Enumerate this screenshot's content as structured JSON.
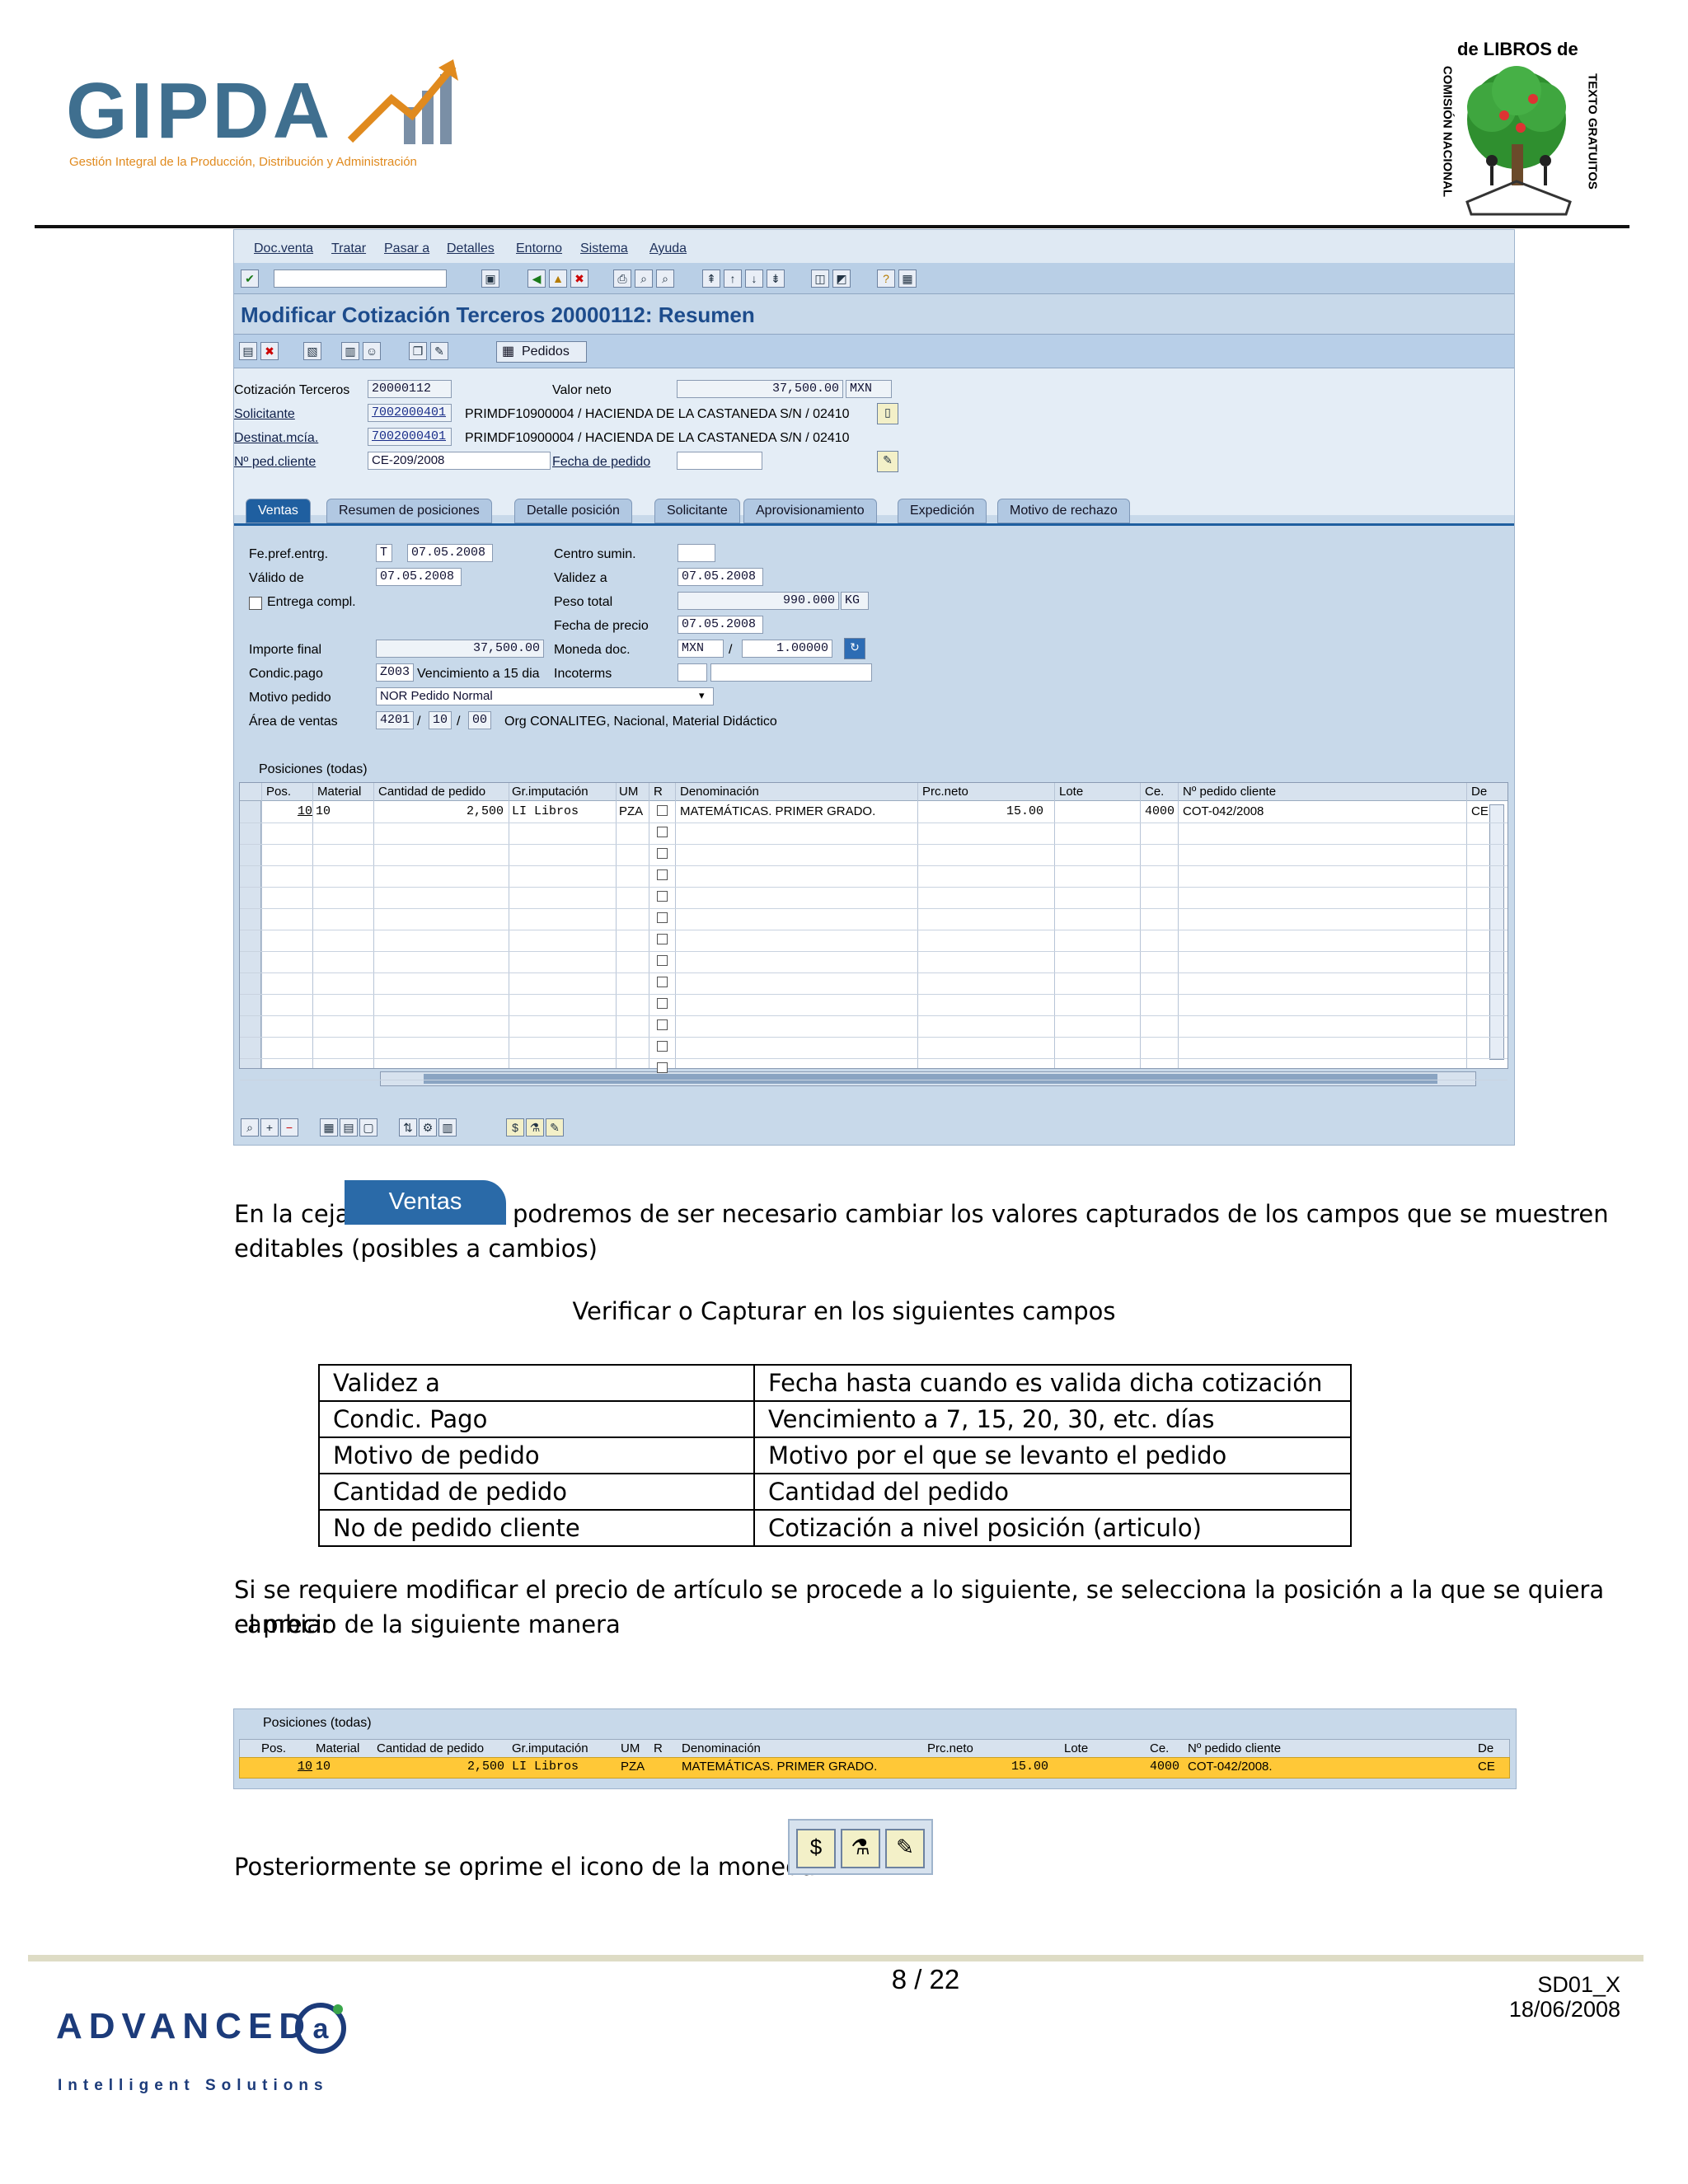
{
  "header": {
    "logo_left_word": "GIPDA",
    "logo_left_tagline": "Gestión Integral de la Producción, Distribución y Administración",
    "logo_right_top": "de LIBROS de",
    "logo_right_left": "COMISIÓN NACIONAL",
    "logo_right_right": "TEXTO GRATUITOS"
  },
  "sap": {
    "menu": [
      "Doc.venta",
      "Tratar",
      "Pasar a",
      "Detalles",
      "Entorno",
      "Sistema",
      "Ayuda"
    ],
    "title": "Modificar Cotización Terceros 20000112: Resumen",
    "pedidos_label": "Pedidos",
    "header_fields": {
      "cotizacion_label": "Cotización Terceros",
      "cotizacion_value": "20000112",
      "valor_neto_label": "Valor neto",
      "valor_neto_value": "37,500.00",
      "valor_neto_currency": "MXN",
      "solicitante_label": "Solicitante",
      "solicitante_value": "7002000401",
      "solicitante_text": "PRIMDF10900004 / HACIENDA DE LA CASTANEDA S/N / 02410",
      "destinat_label": "Destinat.mcía.",
      "destinat_value": "7002000401",
      "destinat_text": "PRIMDF10900004 / HACIENDA DE LA CASTANEDA S/N / 02410",
      "pedcliente_label": "Nº ped.cliente",
      "pedcliente_value": "CE-209/2008",
      "fecha_pedido_label": "Fecha de pedido"
    },
    "tabs": [
      "Ventas",
      "Resumen de posiciones",
      "Detalle posición",
      "Solicitante",
      "Aprovisionamiento",
      "Expedición",
      "Motivo de rechazo"
    ],
    "ventas": {
      "fe_pref_label": "Fe.pref.entrg.",
      "fe_pref_unit": "T",
      "fe_pref_value": "07.05.2008",
      "valido_label": "Válido de",
      "valido_value": "07.05.2008",
      "entrega_label": "Entrega compl.",
      "centro_label": "Centro sumin.",
      "validez_label": "Validez a",
      "validez_value": "07.05.2008",
      "peso_label": "Peso total",
      "peso_value": "990.000",
      "peso_unit": "KG",
      "fecha_precio_label": "Fecha de precio",
      "fecha_precio_value": "07.05.2008",
      "importe_label": "Importe final",
      "importe_value": "37,500.00",
      "moneda_label": "Moneda doc.",
      "moneda_value": "MXN",
      "moneda_rate": "1.00000",
      "condic_label": "Condic.pago",
      "condic_value": "Z003",
      "condic_text": "Vencimiento a 15 dia",
      "incoterms_label": "Incoterms",
      "motivo_label": "Motivo pedido",
      "motivo_value": "NOR Pedido Normal",
      "area_label": "Área de ventas",
      "area_v1": "4201",
      "area_v2": "10",
      "area_v3": "00",
      "area_text": "Org CONALITEG, Nacional, Material Didáctico",
      "sep": "/"
    },
    "grid": {
      "caption": "Posiciones (todas)",
      "columns": [
        "Pos.",
        "Material",
        "Cantidad de pedido",
        "Gr.imputación",
        "UM",
        "R",
        "Denominación",
        "Prc.neto",
        "Lote",
        "Ce.",
        "Nº pedido cliente",
        "De"
      ],
      "row": {
        "pos": "10",
        "material": "10",
        "cantidad": "2,500",
        "grimp": "LI Libros",
        "um": "PZA",
        "denominacion": "MATEMÁTICAS. PRIMER GRADO.",
        "prcneto": "15.00",
        "ce": "4000",
        "pedcliente": "COT-042/2008",
        "de": "CE"
      }
    }
  },
  "body": {
    "para1_a": "En la ceja",
    "ventas_tab": "Ventas",
    "para1_b": "podremos de ser necesario cambiar los valores capturados de los campos que se muestren",
    "para1_c": "editables (posibles a cambios)",
    "center": "Verificar o Capturar en los siguientes campos",
    "table": [
      [
        "Validez a",
        "Fecha hasta cuando es valida dicha cotización"
      ],
      [
        "Condic. Pago",
        "Vencimiento a 7, 15, 20, 30, etc. días"
      ],
      [
        "Motivo de pedido",
        "Motivo por el que se levanto el pedido"
      ],
      [
        "Cantidad de pedido",
        "Cantidad del pedido"
      ],
      [
        "No de pedido cliente",
        "Cotización a nivel posición (articulo)"
      ]
    ],
    "para2_a": "Si se requiere modificar el precio de artículo se procede a lo siguiente, se selecciona la posición a la que se quiera cambiar",
    "para2_b": "el precio de la siguiente manera",
    "snippet_caption": "Posiciones (todas)",
    "snippet_row": {
      "pos": "10",
      "material": "10",
      "cantidad": "2,500",
      "grimp": "LI Libros",
      "um": "PZA",
      "denominacion": "MATEMÁTICAS. PRIMER GRADO.",
      "prcneto": "15.00",
      "ce": "4000",
      "pedcliente": "COT-042/2008.",
      "de": "CE"
    },
    "para3": "Posteriormente se oprime el icono de la moneda"
  },
  "footer": {
    "page": "8 / 22",
    "doc_id": "SD01_X",
    "date": "18/06/2008",
    "logo_word": "ADVANCED",
    "logo_tagline": "Intelligent Solutions"
  }
}
